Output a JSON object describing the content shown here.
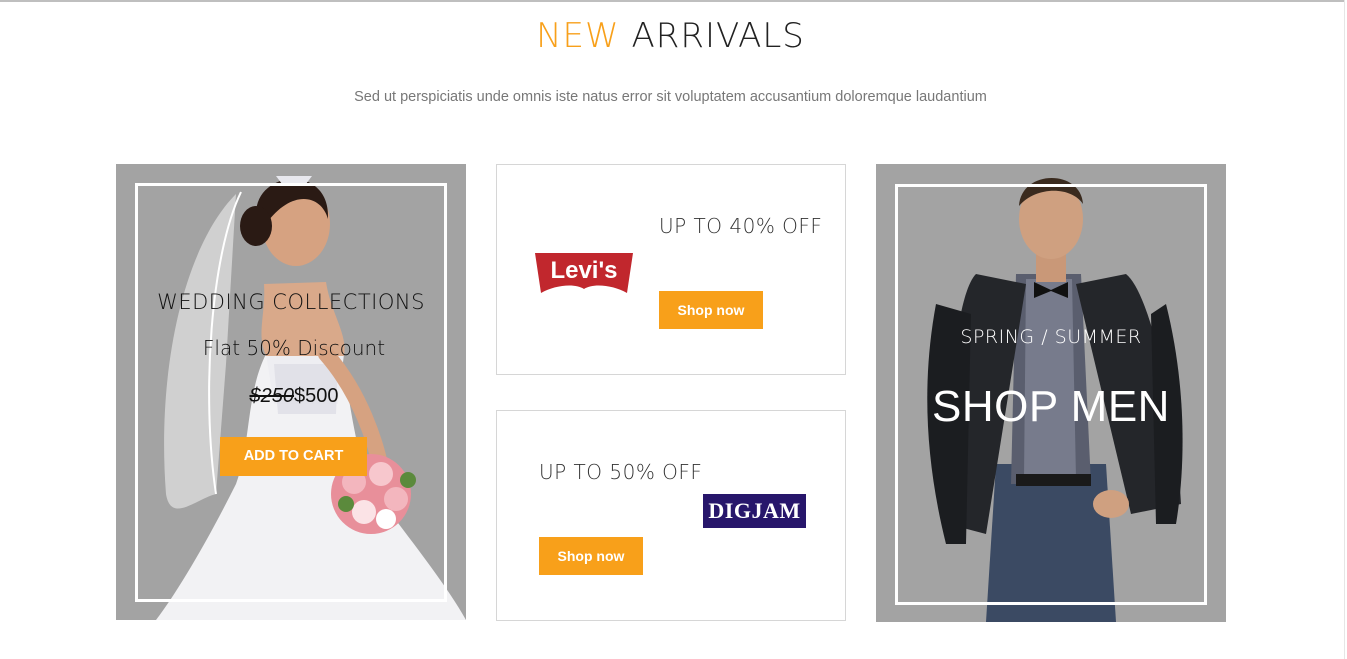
{
  "section": {
    "title_accent": "NEW",
    "title_main": "ARRIVALS",
    "subtitle": "Sed ut perspiciatis unde omnis iste natus error sit voluptatem accusantium doloremque laudantium"
  },
  "wedding_card": {
    "heading": "WEDDING COLLECTIONS",
    "subheading": "Flat 50% Discount",
    "old_price": "$250",
    "new_price": "$500",
    "cart_label": "ADD TO CART"
  },
  "levis_promo": {
    "logo_text": "Levi's",
    "offer": "UP TO 40% OFF",
    "button_label": "Shop now"
  },
  "digjam_promo": {
    "logo_text": "DIGJAM",
    "offer": "UP TO 50% OFF",
    "button_label": "Shop now"
  },
  "men_card": {
    "season": "SPRING / SUMMER",
    "title": "SHOP MEN"
  },
  "colors": {
    "accent": "#f8a01a",
    "card_gray": "#a3a3a3",
    "levis_red": "#c1272d",
    "digjam_navy": "#27166b"
  }
}
